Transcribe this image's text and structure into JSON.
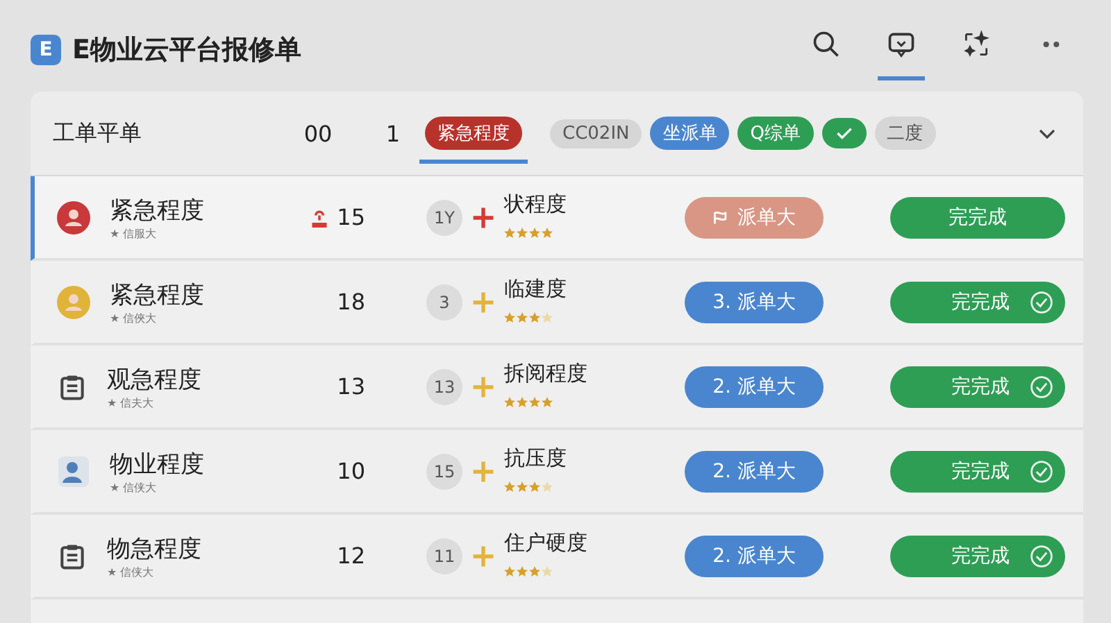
{
  "app": {
    "logo": "E",
    "title": "E物业云平台报修单"
  },
  "toolbar": [
    {
      "kind": "search",
      "selected": false
    },
    {
      "kind": "message",
      "selected": true
    },
    {
      "kind": "sparkle",
      "selected": false
    },
    {
      "kind": "more",
      "selected": false
    }
  ],
  "filter_bar": {
    "title": "工单平单",
    "count_1": "00",
    "count_2": "1",
    "chips": [
      {
        "kind": "text",
        "label": "紧急程度",
        "color": "#b8322c",
        "selected": true
      },
      {
        "kind": "text",
        "label": "CC02IN",
        "color": "#d6d6d6",
        "selected": false
      },
      {
        "kind": "text",
        "label": "坐派单",
        "color": "#4a86cf",
        "selected": false
      },
      {
        "kind": "text",
        "label": "Q综单",
        "color": "#2e9e55",
        "selected": false
      },
      {
        "kind": "check",
        "color": "#2e9e55",
        "selected": false
      },
      {
        "kind": "text",
        "label": "二度",
        "color": "#d6d6d6",
        "selected": false
      }
    ]
  },
  "rows": [
    {
      "kind": "urgent",
      "selected": true,
      "title": "紧急程度",
      "subtitle": "★ 信服大",
      "alert": true,
      "count": "15",
      "bubble": "1Y",
      "label": "状程度",
      "stars": 4,
      "dispatch": {
        "label": "派单大",
        "color": "#d99685",
        "icon": true
      },
      "done": {
        "label": "完完成",
        "check": false
      }
    },
    {
      "kind": "pending",
      "selected": false,
      "title": "紧急程度",
      "subtitle": "★ 信俠大",
      "alert": false,
      "count": "18",
      "bubble": "3",
      "label": "临建度",
      "stars": 3,
      "dispatch": {
        "label": "派单大",
        "prefix": "3.",
        "color": "#4a86cf",
        "icon": false
      },
      "done": {
        "label": "完完成",
        "check": true
      }
    },
    {
      "kind": "document",
      "selected": false,
      "title": "观急程度",
      "subtitle": "★ 信夫大",
      "alert": false,
      "count": "13",
      "bubble": "13",
      "label": "拆阅程度",
      "stars": 4,
      "dispatch": {
        "label": "派单大",
        "prefix": "2.",
        "color": "#4a86cf",
        "icon": false
      },
      "done": {
        "label": "完完成",
        "check": true
      }
    },
    {
      "kind": "user",
      "selected": false,
      "title": "物业程度",
      "subtitle": "★ 信侠大",
      "alert": false,
      "count": "10",
      "bubble": "15",
      "label": "抗压度",
      "stars": 3,
      "dispatch": {
        "label": "派单大",
        "prefix": "2.",
        "color": "#4a86cf",
        "icon": false
      },
      "done": {
        "label": "完完成",
        "check": true
      }
    },
    {
      "kind": "document",
      "selected": false,
      "title": "物急程度",
      "subtitle": "★ 信侠大",
      "alert": false,
      "count": "12",
      "bubble": "11",
      "label": "住户硬度",
      "stars": 3,
      "dispatch": {
        "label": "派单大",
        "prefix": "2.",
        "color": "#4a86cf",
        "icon": false
      },
      "done": {
        "label": "完完成",
        "check": true
      }
    }
  ]
}
